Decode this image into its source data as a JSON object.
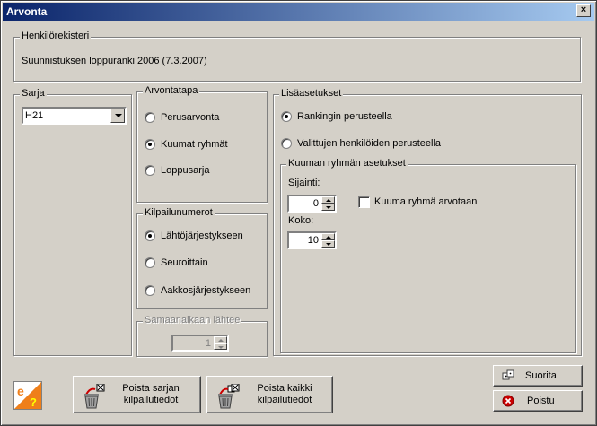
{
  "window": {
    "title": "Arvonta"
  },
  "henkilorekisteri": {
    "legend": "Henkilörekisteri",
    "text": "Suunnistuksen loppuranki 2006  (7.3.2007)"
  },
  "sarja": {
    "legend": "Sarja",
    "value": "H21"
  },
  "arvontatapa": {
    "legend": "Arvontatapa",
    "options": [
      "Perusarvonta",
      "Kuumat ryhmät",
      "Loppusarja"
    ],
    "selected": 1
  },
  "kilpailunumerot": {
    "legend": "Kilpailunumerot",
    "options": [
      "Lähtöjärjestykseen",
      "Seuroittain",
      "Aakkosjärjestykseen"
    ],
    "selected": 0
  },
  "samaanaikaan": {
    "legend": "Samaanaikaan lähtee",
    "value": "1"
  },
  "lisaasetukset": {
    "legend": "Lisäasetukset",
    "options": [
      "Rankingin perusteella",
      "Valittujen henkilöiden perusteella"
    ],
    "selected": 0
  },
  "kuuma": {
    "legend": "Kuuman ryhmän asetukset",
    "sijainti_label": "Sijainti:",
    "sijainti_value": "0",
    "koko_label": "Koko:",
    "koko_value": "10",
    "checkbox_label": "Kuuma ryhmä arvotaan"
  },
  "buttons": {
    "poista_sarjan": [
      "Poista sarjan",
      "kilpailutiedot"
    ],
    "poista_kaikki": [
      "Poista kaikki",
      "kilpailutiedot"
    ],
    "suorita": "Suorita",
    "poistu": "Poistu"
  },
  "colors": {
    "title_start": "#0a246a",
    "title_end": "#a6caf0",
    "face": "#d4d0c8",
    "logo_orange": "#ef7f1a"
  }
}
